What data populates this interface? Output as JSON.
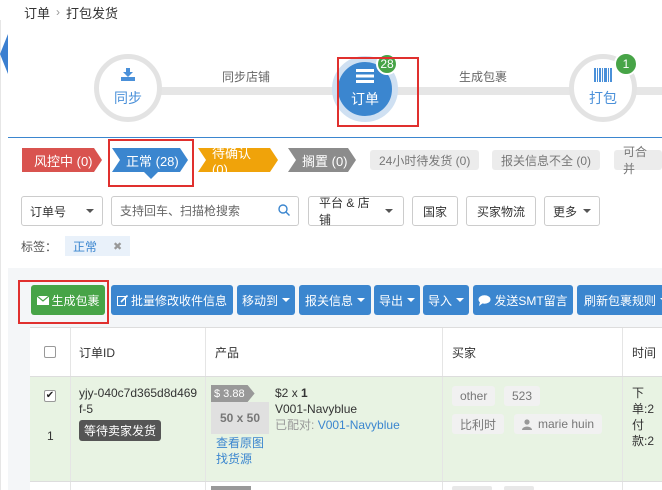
{
  "breadcrumb": {
    "root": "订单",
    "separator": "›",
    "current": "打包发货"
  },
  "workflow": {
    "steps": [
      {
        "label": "同步",
        "icon": "download-icon",
        "badge": ""
      },
      {
        "label": "订单",
        "icon": "list-icon",
        "badge": "28"
      },
      {
        "label": "打包",
        "icon": "barcode-icon",
        "badge": "1"
      }
    ],
    "connectors": [
      "同步店铺",
      "生成包裹"
    ]
  },
  "status_tabs": [
    {
      "label": "风控中 (0)",
      "color": "#d9534f"
    },
    {
      "label": "正常 (28)",
      "color": "#3b86cf"
    },
    {
      "label": "待确认 (0)",
      "color": "#f0a30a"
    },
    {
      "label": "搁置 (0)",
      "color": "#8c8c8c"
    },
    {
      "label": "24小时待发货 (0)"
    },
    {
      "label": "报关信息不全 (0)"
    },
    {
      "label": "可合并"
    }
  ],
  "filters": {
    "order_select": "订单号",
    "search_placeholder": "支持回车、扫描枪搜索",
    "platform_store": "平台 & 店铺",
    "country": "国家",
    "buyer_shipping": "买家物流",
    "more": "更多"
  },
  "tags": {
    "label": "标签：",
    "active_tag": "正常",
    "remove": "✖"
  },
  "toolbar": {
    "generate_package": "生成包裹",
    "batch_edit_recipient": "批量修改收件信息",
    "move_to": "移动到",
    "customs_info": "报关信息",
    "export": "导出",
    "import": "导入",
    "send_smt_message": "发送SMT留言",
    "refresh_package_rules": "刷新包裹规则"
  },
  "table": {
    "columns": [
      "订单ID",
      "产品",
      "买家",
      "时间"
    ],
    "rows": [
      {
        "index": "1",
        "checked": "✔",
        "order_id_line1": "yjy-040c7d365d8d469",
        "order_id_line2": "f-5",
        "status": "等待卖家发货",
        "price": "$ 3.88",
        "thumb_label": "50 x 50",
        "unit_price": "$2",
        "qty_sep": " x ",
        "qty": "1",
        "sku": "V001-Navyblue",
        "matched_label": "已配对:",
        "matched_sku": "V001-Navyblue",
        "view_image": "查看原图",
        "find_source": "找货源",
        "buyer_chips": [
          "other",
          "523",
          "比利时"
        ],
        "buyer_name": "marie huin",
        "time_order": "下单:2",
        "time_pay": "付款:2"
      }
    ]
  }
}
